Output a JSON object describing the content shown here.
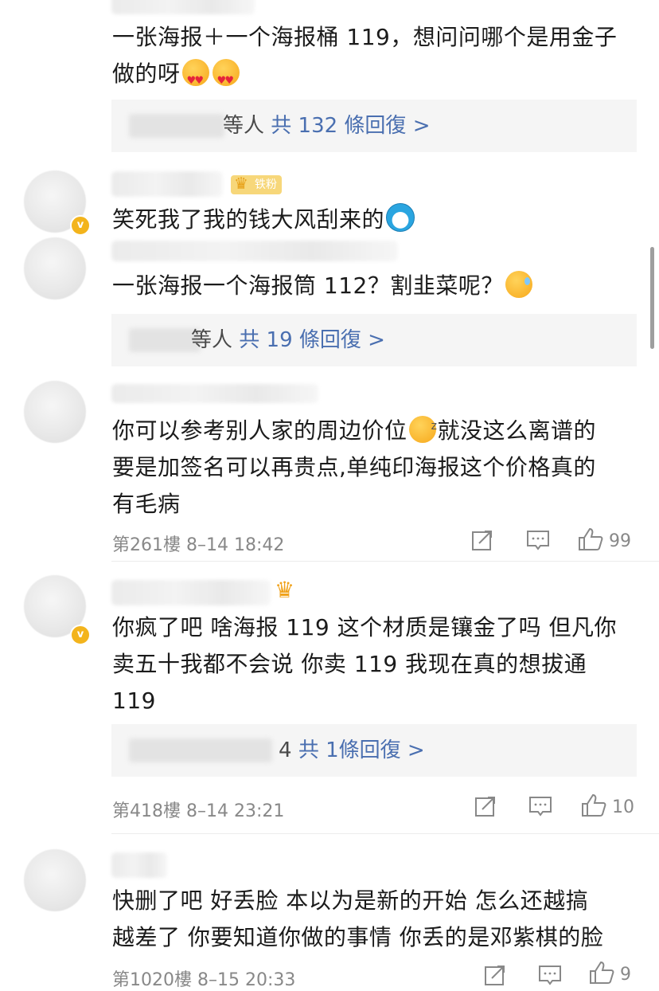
{
  "comments": [
    {
      "text_lines": [
        "一张海报＋一个海报桶 119，想问问哪个是用金子",
        "做的呀"
      ],
      "replies": {
        "suffix": "等人",
        "count_text": "共 132 條回復 >"
      }
    },
    {
      "badge": "铁粉",
      "text_lines": [
        "笑死我了我的钱大风刮来的"
      ]
    },
    {
      "text_lines": [
        "一张海报一个海报筒 112？割韭菜呢？"
      ],
      "replies": {
        "suffix": "等人",
        "count_text": "共 19 條回復 >"
      }
    },
    {
      "text_lines": [
        "你可以参考别人家的周边价位",
        "就没这么离谱的",
        "要是加签名可以再贵点,单纯印海报这个价格真的",
        "有毛病"
      ],
      "floor": "第261樓",
      "time": "8–14 18:42",
      "likes": "99"
    },
    {
      "text_lines": [
        "你疯了吧 啥海报 119 这个材质是镶金了吗 但凡你",
        "卖五十我都不会说 你卖 119 我现在真的想拔通",
        "119"
      ],
      "replies": {
        "suffix": "4",
        "count_text": "共 1條回復 >"
      },
      "floor": "第418樓",
      "time": "8–14 23:21",
      "likes": "10"
    },
    {
      "text_lines": [
        "快删了吧 好丢脸 本以为是新的开始 怎么还越搞",
        "越差了 你要知道你做的事情 你丢的是邓紫棋的脸"
      ],
      "floor": "第1020樓",
      "time": "8–15 20:33",
      "likes": "9"
    }
  ],
  "icons": {
    "share": "share-icon",
    "comment": "comment-icon",
    "like": "thumbs-up-icon"
  }
}
